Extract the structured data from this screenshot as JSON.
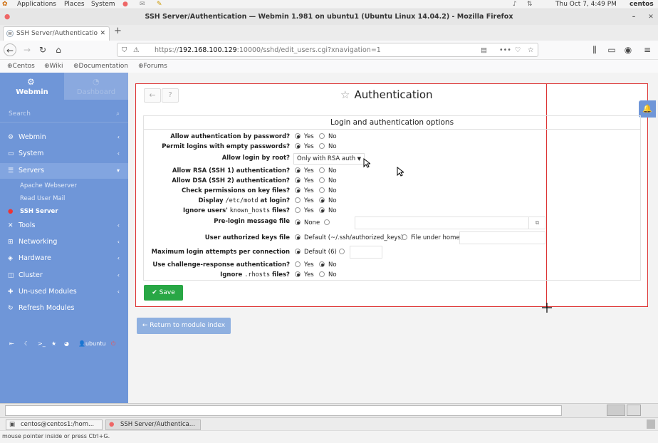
{
  "desktop": {
    "menu": [
      "Applications",
      "Places",
      "System"
    ],
    "clock": "Thu Oct  7,  4:49 PM",
    "user": "centos"
  },
  "window": {
    "title": "SSH Server/Authentication — Webmin 1.981 on ubuntu1 (Ubuntu Linux 14.04.2) - Mozilla Firefox"
  },
  "browser": {
    "tab_title": "SSH Server/Authenticatio",
    "url_prefix": "https://",
    "url_host": "192.168.100.129",
    "url_path": ":10000/sshd/edit_users.cgi?xnavigation=1",
    "bookmarks": [
      "Centos",
      "Wiki",
      "Documentation",
      "Forums"
    ]
  },
  "sidebar": {
    "tab_webmin": "Webmin",
    "tab_dashboard": "Dashboard",
    "search_placeholder": "Search",
    "items": [
      {
        "label": "Webmin",
        "icon": "gear-icon"
      },
      {
        "label": "System",
        "icon": "monitor-icon"
      },
      {
        "label": "Servers",
        "icon": "list-icon"
      },
      {
        "label": "Tools",
        "icon": "wrench-icon"
      },
      {
        "label": "Networking",
        "icon": "network-icon"
      },
      {
        "label": "Hardware",
        "icon": "hardware-icon"
      },
      {
        "label": "Cluster",
        "icon": "layers-icon"
      },
      {
        "label": "Un-used Modules",
        "icon": "puzzle-icon"
      },
      {
        "label": "Refresh Modules",
        "icon": "refresh-icon"
      }
    ],
    "sub_items": [
      "Apache Webserver",
      "Read User Mail",
      "SSH Server"
    ],
    "footer_user": "ubuntu"
  },
  "page": {
    "title": "Authentication",
    "section_title": "Login and authentication options",
    "options": [
      {
        "label": "Allow authentication by password?",
        "yes": "Yes",
        "no": "No",
        "selected": "yes"
      },
      {
        "label": "Permit logins with empty passwords?",
        "yes": "Yes",
        "no": "No",
        "selected": "yes"
      },
      {
        "label": "Allow login by root?",
        "select_value": "Only with RSA auth"
      },
      {
        "label": "Allow RSA (SSH 1) authentication?",
        "yes": "Yes",
        "no": "No",
        "selected": "yes"
      },
      {
        "label": "Allow DSA (SSH 2) authentication?",
        "yes": "Yes",
        "no": "No",
        "selected": "yes"
      },
      {
        "label": "Check permissions on key files?",
        "yes": "Yes",
        "no": "No",
        "selected": "yes"
      },
      {
        "label_pre": "Display ",
        "label_code": "/etc/motd",
        "label_post": " at login?",
        "yes": "Yes",
        "no": "No",
        "selected": "no"
      },
      {
        "label_pre": "Ignore users' ",
        "label_code": "known_hosts",
        "label_post": " files?",
        "yes": "Yes",
        "no": "No",
        "selected": "no"
      }
    ],
    "prelogin": {
      "label": "Pre-login message file",
      "option": "None"
    },
    "authkeys": {
      "label": "User authorized keys file",
      "default": "Default (~/.ssh/authorized_keys)",
      "other": "File under home"
    },
    "maxlogin": {
      "label": "Maximum login attempts per connection",
      "default": "Default (6)"
    },
    "challenge": {
      "label": "Use challenge-response authentication?",
      "yes": "Yes",
      "no": "No",
      "selected": "no"
    },
    "rhosts": {
      "label_pre": "Ignore ",
      "label_code": ".rhosts",
      "label_post": " files?",
      "yes": "Yes",
      "no": "No",
      "selected": "yes"
    },
    "save_label": "Save",
    "return_label": "Return to module index"
  },
  "taskbar": {
    "items": [
      "centos@centos1:/hom...",
      "SSH Server/Authentica..."
    ],
    "hint": "mouse pointer inside or press Ctrl+G."
  },
  "colors": {
    "sidebar": "#6f96d8",
    "save": "#28a745",
    "return": "#8fb0e0",
    "highlight": "#dd3333"
  }
}
